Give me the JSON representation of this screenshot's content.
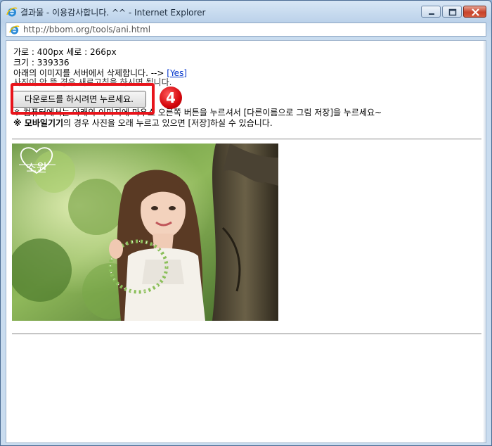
{
  "window": {
    "title": "결과물 - 이용감사합니다. ^^ - Internet Explorer",
    "address": "http://bbom.org/tools/ani.html"
  },
  "info": {
    "dimensions": "가로 : 400px    세로 : 266px",
    "size": "크기 : 339336",
    "delete_prompt": "아래의 이미지를 서버에서 삭제합니다. -->",
    "delete_link": "[Yes]",
    "partial_line": "사진이 안 뜰 경우 새로고침을 하시면 됩니다.",
    "save_hint": "※ 컴퓨터에서는 아래의 이미지에 마우스 오른쪽 버튼을 누르셔서 [다른이름으로 그림 저장]을 누르세요~",
    "mobile_hint_bold": "※ 모바일기기",
    "mobile_hint_rest": "의 경우 사진을 오래 누르고 있으면 [저장]하실 수 있습니다."
  },
  "download_button": "다운로드를 하시려면 누르세요.",
  "annotation": {
    "step_number": "4",
    "highlight_color": "#e8141b"
  },
  "photo": {
    "watermark": "소원"
  }
}
